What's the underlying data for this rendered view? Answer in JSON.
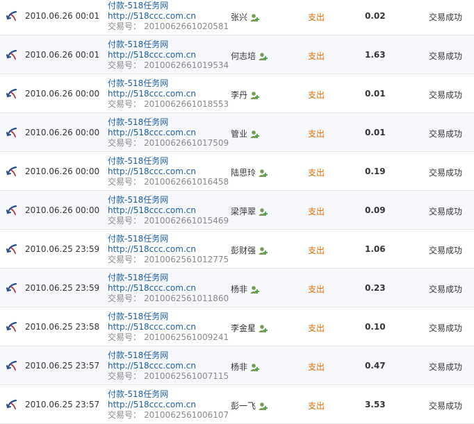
{
  "colors": {
    "link": "#1a5ea8",
    "direction": "#e06a00",
    "muted": "#888888",
    "row_alt": "#f7f8fb",
    "border": "#e3e3e3"
  },
  "icons": {
    "row_type": "payment-arrow-icon",
    "party": "user-add-icon"
  },
  "transactions": [
    {
      "date": "2010.06.26 00:01",
      "title": "付款-518任务网",
      "url": "http://518ccc.com.cn",
      "trade_label": "交易号：",
      "trade_no": "2010062661020581",
      "party": "张兴",
      "direction": "支出",
      "amount": "0.02",
      "status": "交易成功"
    },
    {
      "date": "2010.06.26 00:01",
      "title": "付款-518任务网",
      "url": "http://518ccc.com.cn",
      "trade_label": "交易号：",
      "trade_no": "2010062661019534",
      "party": "何志培",
      "direction": "支出",
      "amount": "1.63",
      "status": "交易成功"
    },
    {
      "date": "2010.06.26 00:00",
      "title": "付款-518任务网",
      "url": "http://518ccc.com.cn",
      "trade_label": "交易号：",
      "trade_no": "2010062661018553",
      "party": "李丹",
      "direction": "支出",
      "amount": "0.01",
      "status": "交易成功"
    },
    {
      "date": "2010.06.26 00:00",
      "title": "付款-518任务网",
      "url": "http://518ccc.com.cn",
      "trade_label": "交易号：",
      "trade_no": "2010062661017509",
      "party": "管业",
      "direction": "支出",
      "amount": "0.01",
      "status": "交易成功"
    },
    {
      "date": "2010.06.26 00:00",
      "title": "付款-518任务网",
      "url": "http://518ccc.com.cn",
      "trade_label": "交易号：",
      "trade_no": "2010062661016458",
      "party": "陆思玲",
      "direction": "支出",
      "amount": "0.19",
      "status": "交易成功"
    },
    {
      "date": "2010.06.26 00:00",
      "title": "付款-518任务网",
      "url": "http://518ccc.com.cn",
      "trade_label": "交易号：",
      "trade_no": "2010062661015469",
      "party": "梁萍翠",
      "direction": "支出",
      "amount": "0.09",
      "status": "交易成功"
    },
    {
      "date": "2010.06.25 23:59",
      "title": "付款-518任务网",
      "url": "http://518ccc.com.cn",
      "trade_label": "交易号：",
      "trade_no": "2010062561012775",
      "party": "彭财强",
      "direction": "支出",
      "amount": "1.06",
      "status": "交易成功"
    },
    {
      "date": "2010.06.25 23:59",
      "title": "付款-518任务网",
      "url": "http://518ccc.com.cn",
      "trade_label": "交易号：",
      "trade_no": "2010062561011860",
      "party": "杨非",
      "direction": "支出",
      "amount": "0.23",
      "status": "交易成功"
    },
    {
      "date": "2010.06.25 23:58",
      "title": "付款-518任务网",
      "url": "http://518ccc.com.cn",
      "trade_label": "交易号：",
      "trade_no": "2010062561009241",
      "party": "李金星",
      "direction": "支出",
      "amount": "0.10",
      "status": "交易成功"
    },
    {
      "date": "2010.06.25 23:57",
      "title": "付款-518任务网",
      "url": "http://518ccc.com.cn",
      "trade_label": "交易号：",
      "trade_no": "2010062561007115",
      "party": "杨非",
      "direction": "支出",
      "amount": "0.47",
      "status": "交易成功"
    },
    {
      "date": "2010.06.25 23:57",
      "title": "付款-518任务网",
      "url": "http://518ccc.com.cn",
      "trade_label": "交易号：",
      "trade_no": "2010062561006107",
      "party": "彭一飞",
      "direction": "支出",
      "amount": "3.53",
      "status": "交易成功"
    }
  ]
}
